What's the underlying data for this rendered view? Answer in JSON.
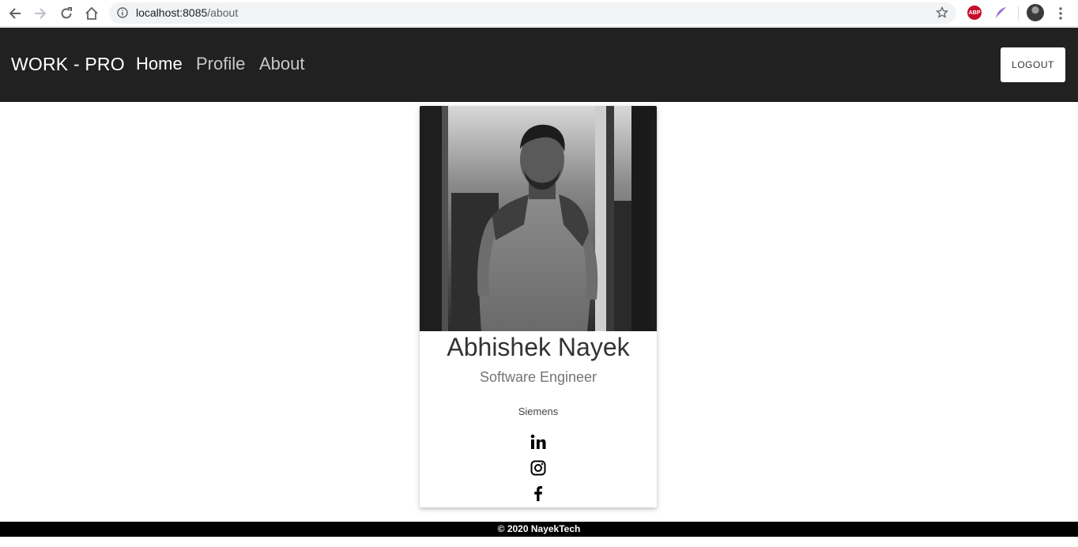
{
  "browser": {
    "url_host": "localhost:8085",
    "url_path": "/about",
    "extensions": [
      {
        "name": "adblock-plus",
        "icon": "abp-icon",
        "label": "ABP"
      },
      {
        "name": "feather",
        "icon": "feather-icon"
      }
    ]
  },
  "navbar": {
    "brand": "WORK - PRO",
    "links": [
      {
        "label": "Home",
        "active": true
      },
      {
        "label": "Profile",
        "active": false
      },
      {
        "label": "About",
        "active": false
      }
    ],
    "logout_label": "LOGOUT"
  },
  "profile": {
    "name": "Abhishek Nayek",
    "role": "Software Engineer",
    "company": "Siemens",
    "social": [
      "linkedin-icon",
      "instagram-icon",
      "facebook-icon"
    ]
  },
  "footer": {
    "text": "© 2020 NayekTech"
  },
  "colors": {
    "navbar_bg": "#212121",
    "footer_bg": "#000000",
    "text_primary": "#333333",
    "text_secondary": "#757575"
  }
}
